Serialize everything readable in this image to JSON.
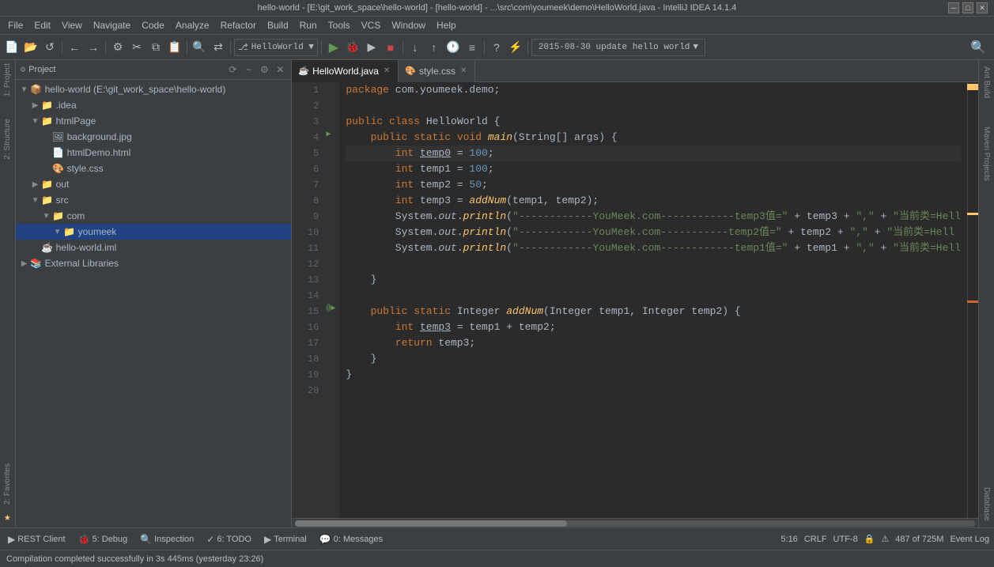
{
  "titlebar": {
    "text": "hello-world - [E:\\git_work_space\\hello-world] - [hello-world] - ...\\src\\com\\youmeek\\demo\\HelloWorld.java - IntelliJ IDEA 14.1.4"
  },
  "menubar": {
    "items": [
      "File",
      "Edit",
      "View",
      "Navigate",
      "Code",
      "Analyze",
      "Refactor",
      "Build",
      "Run",
      "Tools",
      "VCS",
      "Window",
      "Help"
    ]
  },
  "project_panel": {
    "title": "Project",
    "tree": [
      {
        "id": "hello-world",
        "label": "hello-world (E:\\git_work_space\\hello-world)",
        "indent": 0,
        "expanded": true,
        "type": "module"
      },
      {
        "id": "idea",
        "label": ".idea",
        "indent": 1,
        "expanded": false,
        "type": "folder"
      },
      {
        "id": "htmlPage",
        "label": "htmlPage",
        "indent": 1,
        "expanded": true,
        "type": "folder"
      },
      {
        "id": "background",
        "label": "background.jpg",
        "indent": 2,
        "type": "img"
      },
      {
        "id": "htmlDemo",
        "label": "htmlDemo.html",
        "indent": 2,
        "type": "html"
      },
      {
        "id": "style",
        "label": "style.css",
        "indent": 2,
        "type": "css"
      },
      {
        "id": "out",
        "label": "out",
        "indent": 1,
        "expanded": false,
        "type": "folder"
      },
      {
        "id": "src",
        "label": "src",
        "indent": 1,
        "expanded": true,
        "type": "folder"
      },
      {
        "id": "com",
        "label": "com",
        "indent": 2,
        "expanded": true,
        "type": "folder"
      },
      {
        "id": "youmeek",
        "label": "youmeek",
        "indent": 3,
        "expanded": true,
        "type": "folder",
        "highlighted": true
      },
      {
        "id": "hello-world-iml",
        "label": "hello-world.iml",
        "indent": 1,
        "type": "iml"
      },
      {
        "id": "external-libraries",
        "label": "External Libraries",
        "indent": 0,
        "expanded": false,
        "type": "lib"
      }
    ]
  },
  "tabs": [
    {
      "id": "helloworld-tab",
      "label": "HelloWorld.java",
      "type": "java",
      "active": true
    },
    {
      "id": "style-tab",
      "label": "style.css",
      "type": "css",
      "active": false
    }
  ],
  "editor": {
    "filename": "HelloWorld.java",
    "lines": [
      {
        "num": 1,
        "code": "package com.youmeek.demo;",
        "type": "normal"
      },
      {
        "num": 2,
        "code": "",
        "type": "normal"
      },
      {
        "num": 3,
        "code": "public class HelloWorld {",
        "type": "normal"
      },
      {
        "num": 4,
        "code": "    public static void main(String[] args) {",
        "type": "normal"
      },
      {
        "num": 5,
        "code": "        int temp0 = 100;",
        "type": "normal"
      },
      {
        "num": 6,
        "code": "        int temp1 = 100;",
        "type": "normal"
      },
      {
        "num": 7,
        "code": "        int temp2 = 50;",
        "type": "normal"
      },
      {
        "num": 8,
        "code": "        int temp3 = addNum(temp1, temp2);",
        "type": "normal"
      },
      {
        "num": 9,
        "code": "        System.out.println(\"------------YouMeek.com------------temp3值=\" + temp3 + \",\" + \"当前类=Hell",
        "type": "normal"
      },
      {
        "num": 10,
        "code": "        System.out.println(\"------------YouMeek.com-----------temp2值=\" + temp2 + \",\" + \"当前类=Hell",
        "type": "normal"
      },
      {
        "num": 11,
        "code": "        System.out.println(\"------------YouMeek.com------------temp1值=\" + temp1 + \",\" + \"当前类=Hell",
        "type": "normal"
      },
      {
        "num": 12,
        "code": "",
        "type": "normal"
      },
      {
        "num": 13,
        "code": "    }",
        "type": "normal"
      },
      {
        "num": 14,
        "code": "",
        "type": "normal"
      },
      {
        "num": 15,
        "code": "    public static Integer addNum(Integer temp1, Integer temp2) {",
        "type": "normal"
      },
      {
        "num": 16,
        "code": "        int temp3 = temp1 + temp2;",
        "type": "normal"
      },
      {
        "num": 17,
        "code": "        return temp3;",
        "type": "normal"
      },
      {
        "num": 18,
        "code": "    }",
        "type": "normal"
      },
      {
        "num": 19,
        "code": "}",
        "type": "normal"
      },
      {
        "num": 20,
        "code": "",
        "type": "normal"
      }
    ]
  },
  "right_tabs": [
    "Ant Build",
    "Maven Projects",
    "Database"
  ],
  "bottom_tools": [
    {
      "icon": "▶",
      "label": "REST Client"
    },
    {
      "icon": "🐞",
      "label": "5: Debug"
    },
    {
      "icon": "🔍",
      "label": "Inspection"
    },
    {
      "icon": "✓",
      "label": "6: TODO"
    },
    {
      "icon": "▶",
      "label": "Terminal"
    },
    {
      "icon": "💬",
      "label": "0: Messages"
    }
  ],
  "status_right": {
    "line_col": "5:16",
    "crlf": "CRLF",
    "encoding": "UTF-8",
    "line_count": "487 of 725M",
    "event_log": "Event Log"
  },
  "message_bar": {
    "text": "Compilation completed successfully in 3s 445ms (yesterday 23:26)"
  },
  "toolbar": {
    "branch": "HelloWorld ▼",
    "commit_msg": "2015-08-30 update hello world",
    "run_icon": "▶",
    "debug_icon": "🐞",
    "stop_icon": "■"
  },
  "left_tabs": [
    "1: Project",
    "2: Structure",
    "2: Favorites"
  ]
}
